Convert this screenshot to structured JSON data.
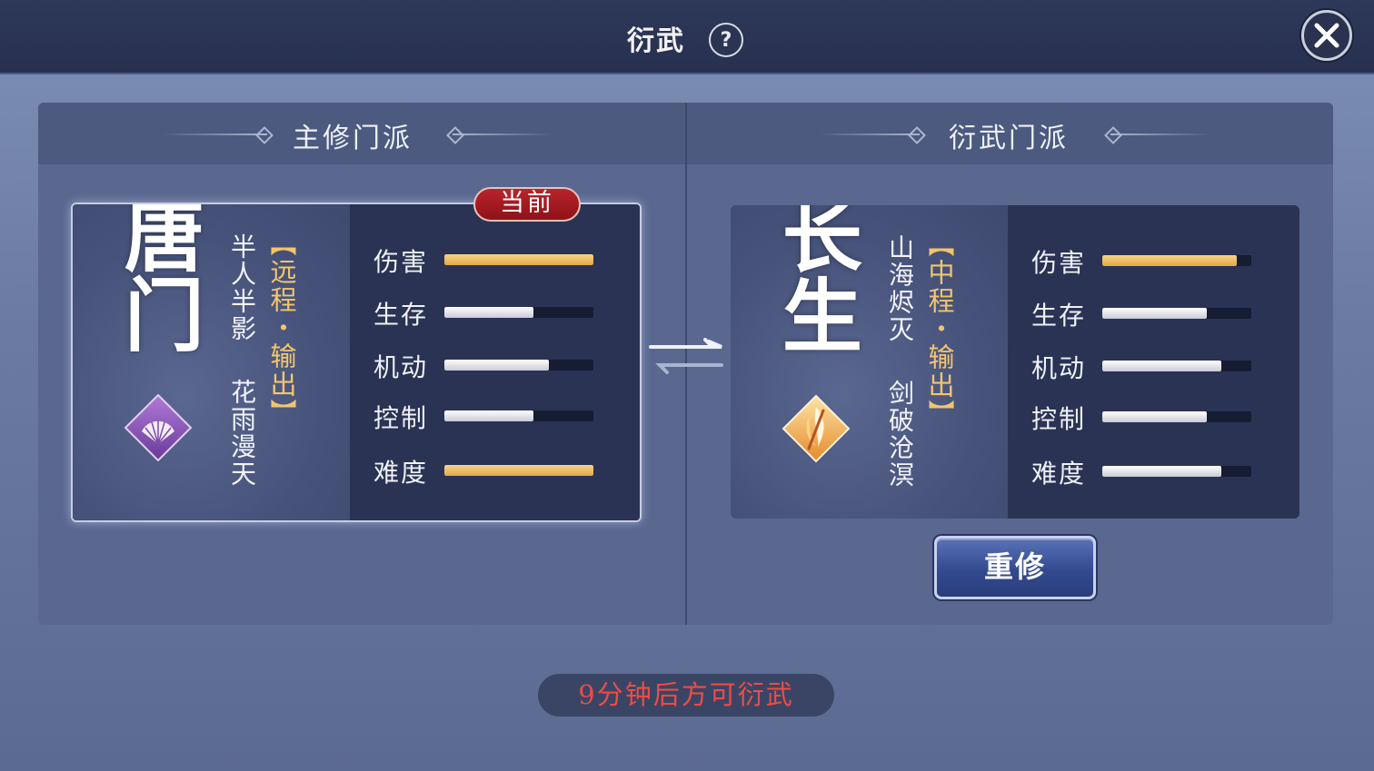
{
  "header": {
    "title": "衍武",
    "help_label": "?"
  },
  "columns": {
    "main_school_header": "主修门派",
    "derived_school_header": "衍武门派"
  },
  "current_school": {
    "name": "唐门",
    "role": "【远程・输出】",
    "skills": [
      "半人半影",
      "花雨漫天"
    ],
    "badge": "当前",
    "emblem_icon": "fan-icon",
    "emblem_color": "#8b5cb3",
    "stats": [
      {
        "label": "伤害",
        "value": 1.0,
        "color": "gold"
      },
      {
        "label": "生存",
        "value": 0.6,
        "color": "white"
      },
      {
        "label": "机动",
        "value": 0.7,
        "color": "white"
      },
      {
        "label": "控制",
        "value": 0.6,
        "color": "white"
      },
      {
        "label": "难度",
        "value": 1.0,
        "color": "gold"
      }
    ]
  },
  "target_school": {
    "name": "长生",
    "role": "【中程・输出】",
    "skills": [
      "山海烬灭",
      "剑破沧溟"
    ],
    "emblem_icon": "flame-sword-icon",
    "emblem_color": "#f0a948",
    "stats": [
      {
        "label": "伤害",
        "value": 0.9,
        "color": "gold"
      },
      {
        "label": "生存",
        "value": 0.7,
        "color": "white"
      },
      {
        "label": "机动",
        "value": 0.8,
        "color": "white"
      },
      {
        "label": "控制",
        "value": 0.7,
        "color": "white"
      },
      {
        "label": "难度",
        "value": 0.8,
        "color": "white"
      }
    ],
    "relearn_label": "重修"
  },
  "swap_icon": "swap-arrows-icon",
  "cooldown_text": "9分钟后方可衍武",
  "colors": {
    "accent_gold": "#f3c56b",
    "badge_red": "#a01a22",
    "warning_red": "#ef4b45"
  }
}
